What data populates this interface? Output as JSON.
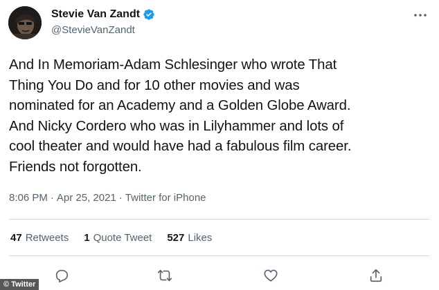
{
  "author": {
    "display_name": "Stevie Van Zandt",
    "handle": "@StevieVanZandt",
    "verified": true
  },
  "tweet": {
    "text": "And In Memoriam-Adam Schlesinger who wrote That\nThing You Do and for 10 other movies and was\nnominated for an Academy and a Golden Globe Award.\nAnd Nicky Cordero who was in Lilyhammer and lots of\ncool theater and would have had a fabulous film career.\nFriends not forgotten.",
    "time": "8:06 PM",
    "separator": "·",
    "date": "Apr 25, 2021",
    "source": "Twitter for iPhone"
  },
  "stats": {
    "retweets_count": "47",
    "retweets_label": "Retweets",
    "quotes_count": "1",
    "quotes_label": "Quote Tweet",
    "likes_count": "527",
    "likes_label": "Likes"
  },
  "actions": {
    "icons": [
      "reply-icon",
      "retweet-icon",
      "like-icon",
      "share-icon"
    ]
  },
  "watermark": {
    "label": "Twitter"
  },
  "colors": {
    "text_primary": "#0f1419",
    "text_secondary": "#536471",
    "verified_blue": "#1d9bf0",
    "divider": "#cfd9de"
  }
}
